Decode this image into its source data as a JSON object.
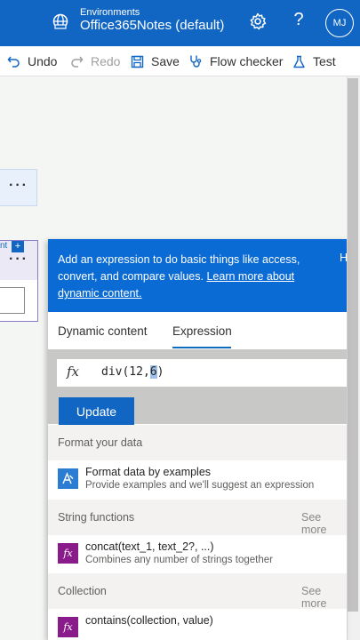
{
  "header": {
    "env_caption": "Environments",
    "env_name": "Office365Notes (default)",
    "avatar_initials": "MJ",
    "help_glyph": "?"
  },
  "toolbar": {
    "undo": "Undo",
    "redo": "Redo",
    "save": "Save",
    "flow_checker": "Flow checker",
    "test": "Test"
  },
  "canvas": {
    "card_menu": "···",
    "card2_menu": "···",
    "card2_link_fragment": "nt",
    "add_badge": "+"
  },
  "popup": {
    "banner_text": "Add an expression to do basic things like access, convert, and compare values.",
    "banner_link": "Learn more about dynamic content.",
    "banner_hide": "H",
    "tabs": [
      {
        "label": "Dynamic content",
        "active": false
      },
      {
        "label": "Expression",
        "active": true
      }
    ],
    "expression": {
      "fx": "fx",
      "value_before": "div(12,",
      "value_selected": "6",
      "value_after": ")"
    },
    "update_label": "Update",
    "sections": [
      {
        "title": "Format your data",
        "see_more": "",
        "items": [
          {
            "title": "Format data by examples",
            "description": "Provide examples and we'll suggest an expression",
            "icon": "format-data-icon"
          }
        ]
      },
      {
        "title": "String functions",
        "see_more": "See more",
        "items": [
          {
            "title": "concat(text_1, text_2?, ...)",
            "description": "Combines any number of strings together",
            "icon": "function-icon"
          }
        ]
      },
      {
        "title": "Collection",
        "see_more": "See more",
        "items": [
          {
            "title": "contains(collection, value)",
            "description": "",
            "icon": "function-icon"
          }
        ]
      }
    ]
  },
  "colors": {
    "brand_blue": "#1166c4",
    "function_purple": "#8a1b8a",
    "format_blue": "#2b7cd3"
  }
}
